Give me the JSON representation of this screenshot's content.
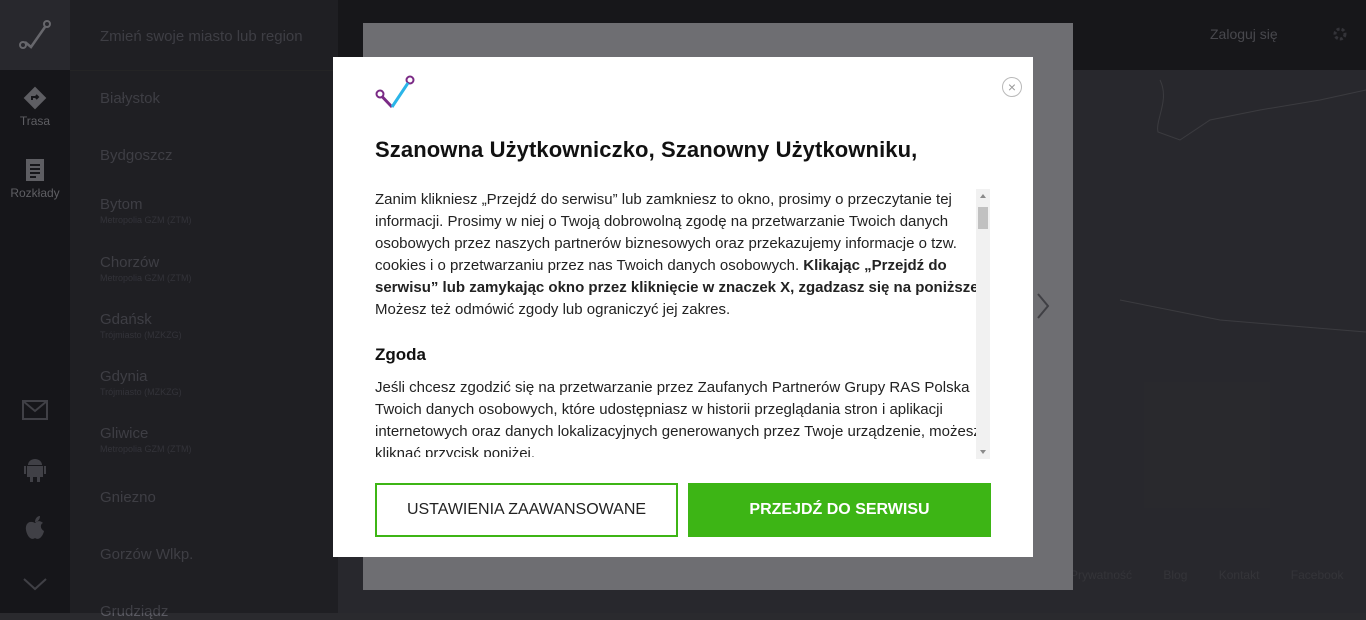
{
  "sidebar": {
    "items": [
      {
        "label": "Trasa",
        "icon": "route-icon"
      },
      {
        "label": "Rozkłady",
        "icon": "timetable-icon"
      }
    ],
    "bottom_icons": [
      "mail-icon",
      "android-icon",
      "apple-icon",
      "chevron-down-icon"
    ]
  },
  "city_search": {
    "placeholder": "Zmień swoje miasto lub region"
  },
  "cities": [
    {
      "name": "Białystok",
      "sub": ""
    },
    {
      "name": "Bydgoszcz",
      "sub": ""
    },
    {
      "name": "Bytom",
      "sub": "Metropolia GZM (ZTM)"
    },
    {
      "name": "Chorzów",
      "sub": "Metropolia GZM (ZTM)"
    },
    {
      "name": "Gdańsk",
      "sub": "Trójmiasto (MZKZG)"
    },
    {
      "name": "Gdynia",
      "sub": "Trójmiasto (MZKZG)"
    },
    {
      "name": "Gliwice",
      "sub": "Metropolia GZM (ZTM)"
    },
    {
      "name": "Gniezno",
      "sub": ""
    },
    {
      "name": "Gorzów Wlkp.",
      "sub": ""
    },
    {
      "name": "Grudziądz",
      "sub": ""
    }
  ],
  "header": {
    "login_label": "Zaloguj się"
  },
  "footer": {
    "links": [
      "Prywatność",
      "Blog",
      "Kontakt",
      "Facebook"
    ]
  },
  "modal": {
    "title": "Szanowna Użytkowniczko, Szanowny Użytkowniku,",
    "intro_1": "Zanim klikniesz „Przejdź do serwisu” lub zamkniesz to okno, prosimy o przeczytanie tej informacji. Prosimy w niej o Twoją dobrowolną zgodę na przetwarzanie Twoich danych osobowych przez naszych partnerów biznesowych oraz przekazujemy informacje o tzw. cookies i o przetwarzaniu przez nas Twoich danych osobowych. ",
    "intro_bold": "Klikając „Przejdź do serwisu” lub zamykając okno przez kliknięcie w znaczek X, zgadzasz się na poniższe.",
    "intro_2": " Możesz też odmówić zgody lub ograniczyć jej zakres.",
    "section_title": "Zgoda",
    "section_text": "Jeśli chcesz zgodzić się na przetwarzanie przez Zaufanych Partnerów Grupy RAS Polska Twoich danych osobowych, które udostępniasz w historii przeglądania stron i aplikacji internetowych oraz danych lokalizacyjnych generowanych przez Twoje urządzenie, możesz kliknąć przycisk poniżej.",
    "btn_advanced": "USTAWIENIA ZAAWANSOWANE",
    "btn_go": "PRZEJDŹ DO SERWISU",
    "close_symbol": "×"
  },
  "colors": {
    "accent_green": "#3db515",
    "logo_purple": "#7a2a85",
    "logo_blue": "#2bb5e8"
  }
}
